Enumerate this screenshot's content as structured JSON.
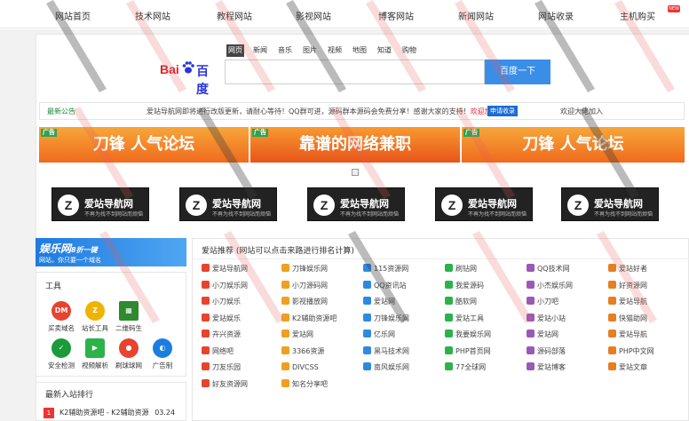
{
  "topnav": {
    "items": [
      "网站首页",
      "技术网站",
      "教程网站",
      "影视网站",
      "博客网站",
      "新闻网站",
      "网站收录",
      "主机购买"
    ],
    "badge": "NEW"
  },
  "search": {
    "tabs": [
      "网页",
      "新闻",
      "音乐",
      "图片",
      "视频",
      "地图",
      "知道",
      "购物"
    ],
    "active_tab": "网页",
    "placeholder": "",
    "button": "百度一下",
    "logo_left": "Bai",
    "logo_right": "百度"
  },
  "notice": {
    "label": "最新公告",
    "text": "爱站导航网即将进行改版更新，请耐心等待！",
    "text2": "QQ群可进，源码群本源码会免费分享！感谢大家的支持！",
    "highlight": "欢迎加入本群",
    "badge": "申请收录",
    "right": "欢迎大佬加入"
  },
  "banners": [
    {
      "tag": "广告",
      "text": "刀锋 人气论坛"
    },
    {
      "tag": "广告",
      "text": "靠谱的网络兼职"
    },
    {
      "tag": "广告",
      "text": "刀锋 人气论坛"
    }
  ],
  "tiles": [
    {
      "letter": "Z",
      "name": "爱站导航网",
      "sub": "不再为找不到网站而烦恼"
    },
    {
      "letter": "Z",
      "name": "爱站导航网",
      "sub": "不再为找不到网站而烦恼"
    },
    {
      "letter": "Z",
      "name": "爱站导航网",
      "sub": "不再为找不到网站而烦恼"
    },
    {
      "letter": "Z",
      "name": "爱站导航网",
      "sub": "不再为找不到网站而烦恼"
    },
    {
      "letter": "Z",
      "name": "爱站导航网",
      "sub": "不再为找不到网站而烦恼"
    }
  ],
  "left_ad": {
    "title": "娱乐网",
    "title_suffix": "8折一键",
    "sub": "网站，你只要一个域名",
    "tag": "网站"
  },
  "tools": {
    "heading": "工具",
    "items": [
      {
        "label": "买卖域名",
        "icon": "domain-icon",
        "glyph": "DM",
        "color": "#e8432e"
      },
      {
        "label": "站长工具",
        "icon": "z-icon",
        "glyph": "Z",
        "color": "#f0b400"
      },
      {
        "label": "二维码生",
        "icon": "qrcode-icon",
        "glyph": "▦",
        "color": "#2d8a2d"
      },
      {
        "label": "安全检测",
        "icon": "shield-icon",
        "glyph": "✓",
        "color": "#1a9a3a"
      },
      {
        "label": "视频解析",
        "icon": "video-icon",
        "glyph": "▶",
        "color": "#2bb34a"
      },
      {
        "label": "刷球球网",
        "icon": "ball-icon",
        "glyph": "●",
        "color": "#e8432e"
      },
      {
        "label": "广告制",
        "icon": "ad-icon",
        "glyph": "◐",
        "color": "#1a7ee0"
      }
    ]
  },
  "rank": {
    "heading": "最新入站排行",
    "rows": [
      {
        "num": "1",
        "name": "K2辅助资源吧 - K2辅助资源",
        "date": "03.24"
      }
    ]
  },
  "recommend": {
    "heading": "爱站推荐 (网站可以点击来路进行排名计算)",
    "sites": [
      "爱站导航网",
      "刀锋娱乐网",
      "115资源网",
      "刷钻网",
      "QQ技术网",
      "爱站好者",
      "小刀娱乐网",
      "小刀源码网",
      "QQ资讯站",
      "我爱源码",
      "小杰娱乐网",
      "好资源网",
      "小刀娱乐",
      "影视播放网",
      "爱站网",
      "酷软网",
      "小刀吧",
      "爱站导航",
      "爱站娱乐",
      "K2辅助资源吧",
      "刀锋娱乐网",
      "爱站工具",
      "爱站小站",
      "快猫助网",
      "卉兴资源",
      "爱站网",
      "亿乐网",
      "我要娱乐网",
      "爱站网",
      "爱站导航",
      "网络吧",
      "3366资源",
      "黑马技术网",
      "PHP首页网",
      "源码部落",
      "PHP中文网",
      "刀友乐园",
      "DIVCSS",
      "南风娱乐网",
      "77全球网",
      "爱站博客",
      "爱站文章",
      "好友资源网",
      "知名分享吧"
    ]
  }
}
